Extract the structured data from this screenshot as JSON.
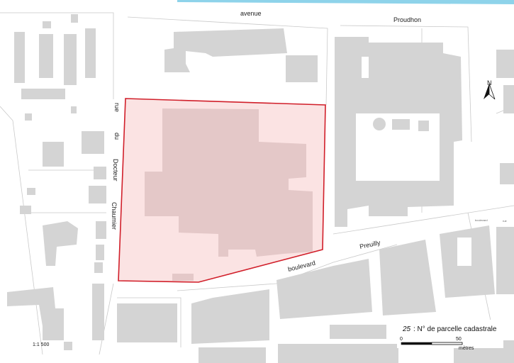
{
  "map": {
    "street_labels": {
      "avenue": "avenue",
      "proudhon": "Proudhon",
      "rue": "rue",
      "du": "du",
      "docteur": "Docteur",
      "chaumier": "Chaumier",
      "boulevard": "boulevard",
      "preuilly": "Preuilly",
      "small_a": "boulevard",
      "small_b": "rue"
    },
    "north_label": "N",
    "scale_ratio": "1:1 500",
    "legend": {
      "sample_number": "25",
      "description": ": N° de parcelle cadastrale"
    },
    "scalebar": {
      "start": "0",
      "end": "50",
      "unit": "mètres"
    },
    "colors": {
      "parcel_fill": "#f9d6d6",
      "parcel_stroke": "#d11f2a",
      "building": "#d4d4d4",
      "plot_line": "#c9c9c9",
      "corner_band": "#8ed3ea"
    }
  }
}
